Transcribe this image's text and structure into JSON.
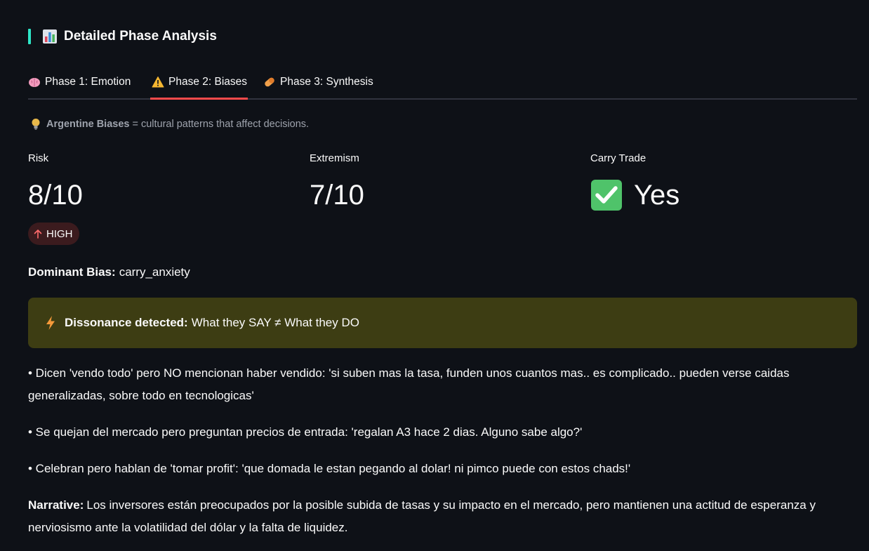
{
  "header": {
    "title": "Detailed Phase Analysis",
    "accent_color": "#2ee6c7",
    "icon": "bar-chart-icon"
  },
  "tabs": [
    {
      "label": "Phase 1: Emotion",
      "icon": "brain-icon",
      "active": false
    },
    {
      "label": "Phase 2: Biases",
      "icon": "warning-icon",
      "active": true
    },
    {
      "label": "Phase 3: Synthesis",
      "icon": "pill-icon",
      "active": false
    }
  ],
  "active_tab_color": "#ff4b4b",
  "caption": {
    "icon": "lightbulb-icon",
    "bold": "Argentine Biases",
    "text": "= cultural patterns that affect decisions."
  },
  "metrics": [
    {
      "label": "Risk",
      "value": "8/10",
      "delta": "HIGH",
      "delta_icon": "arrow-up-icon",
      "delta_color": "#ff4b4b"
    },
    {
      "label": "Extremism",
      "value": "7/10"
    },
    {
      "label": "Carry Trade",
      "value": "Yes",
      "icon": "check-mark-icon"
    }
  ],
  "dominant_bias": {
    "label": "Dominant Bias:",
    "value": "carry_anxiety"
  },
  "warning": {
    "icon": "lightning-icon",
    "bold": "Dissonance detected:",
    "text": "What they SAY ≠ What they DO",
    "background": "#3d3d13"
  },
  "bullets": [
    "• Dicen 'vendo todo' pero NO mencionan haber vendido: 'si suben mas la tasa, funden unos cuantos mas.. es complicado.. pueden verse caidas generalizadas, sobre todo en tecnologicas'",
    "• Se quejan del mercado pero preguntan precios de entrada: 'regalan A3 hace 2 dias. Alguno sabe algo?'",
    "• Celebran pero hablan de 'tomar profit': 'que domada le estan pegando al dolar! ni pimco puede con estos chads!'"
  ],
  "narrative": {
    "label": "Narrative:",
    "text": "Los inversores están preocupados por la posible subida de tasas y su impacto en el mercado, pero mantienen una actitud de esperanza y nerviosismo ante la volatilidad del dólar y la falta de liquidez."
  }
}
